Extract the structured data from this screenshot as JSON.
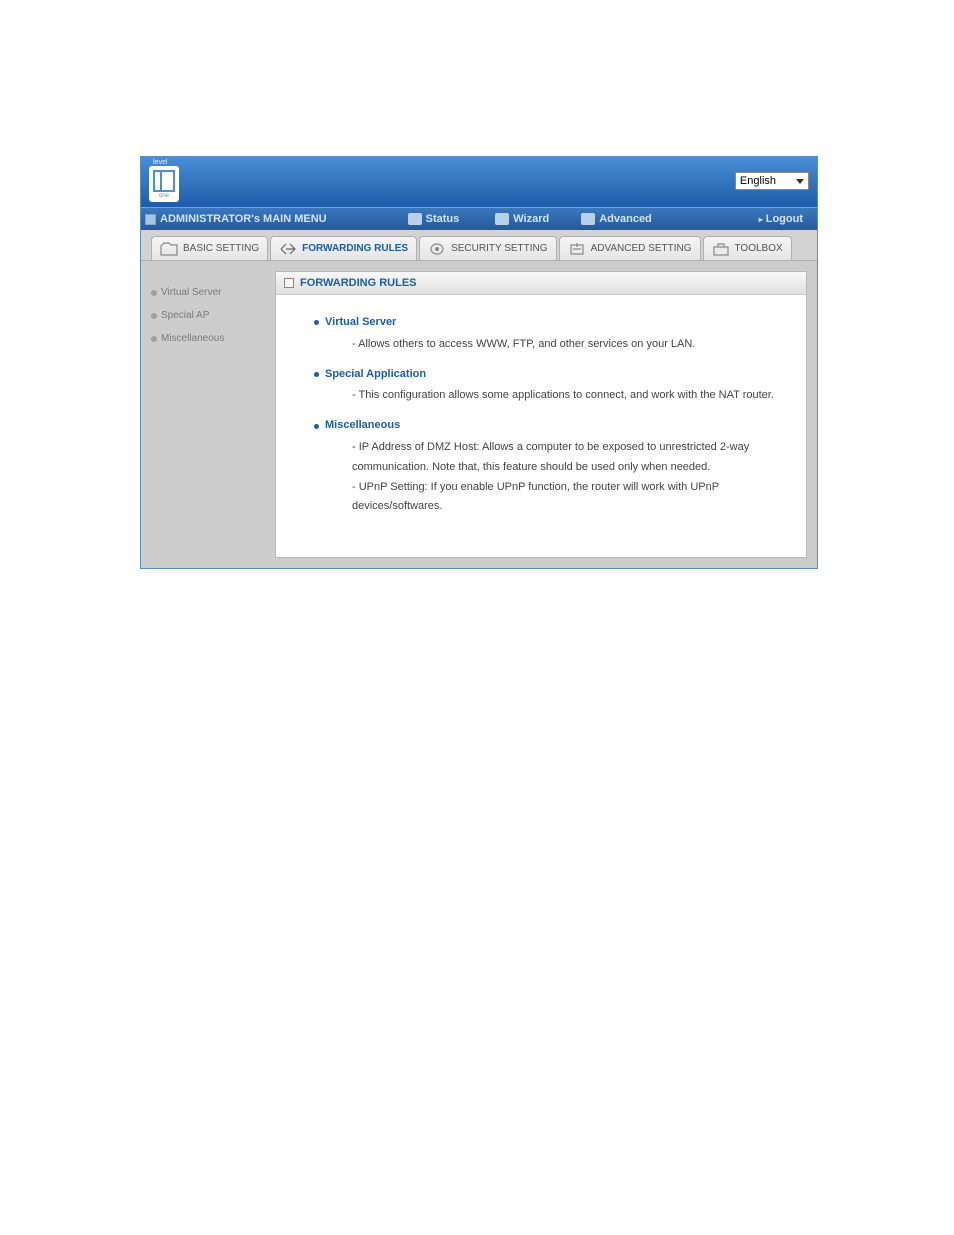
{
  "brand": {
    "top": "level",
    "bottom": "one"
  },
  "language": "English",
  "topmenu": {
    "title": "ADMINISTRATOR's MAIN MENU",
    "items": [
      {
        "label": "Status"
      },
      {
        "label": "Wizard"
      },
      {
        "label": "Advanced"
      }
    ],
    "logout": "Logout"
  },
  "tabs": [
    {
      "label": "BASIC SETTING"
    },
    {
      "label": "FORWARDING RULES"
    },
    {
      "label": "SECURITY SETTING"
    },
    {
      "label": "ADVANCED SETTING"
    },
    {
      "label": "TOOLBOX"
    }
  ],
  "sidebar": [
    {
      "label": "Virtual Server"
    },
    {
      "label": "Special AP"
    },
    {
      "label": "Miscellaneous"
    }
  ],
  "panel": {
    "title": "FORWARDING RULES",
    "items": [
      {
        "heading": "Virtual Server",
        "desc": "- Allows others to access WWW, FTP, and other services on your LAN."
      },
      {
        "heading": "Special Application",
        "desc": "- This configuration allows some applications to connect, and work with the NAT router."
      },
      {
        "heading": "Miscellaneous",
        "desc": "- IP Address of DMZ Host: Allows a computer to be exposed to unrestricted 2-way communication. Note that, this feature should be used only when needed.\n- UPnP Setting: If you enable UPnP function, the router will work with UPnP devices/softwares."
      }
    ]
  }
}
